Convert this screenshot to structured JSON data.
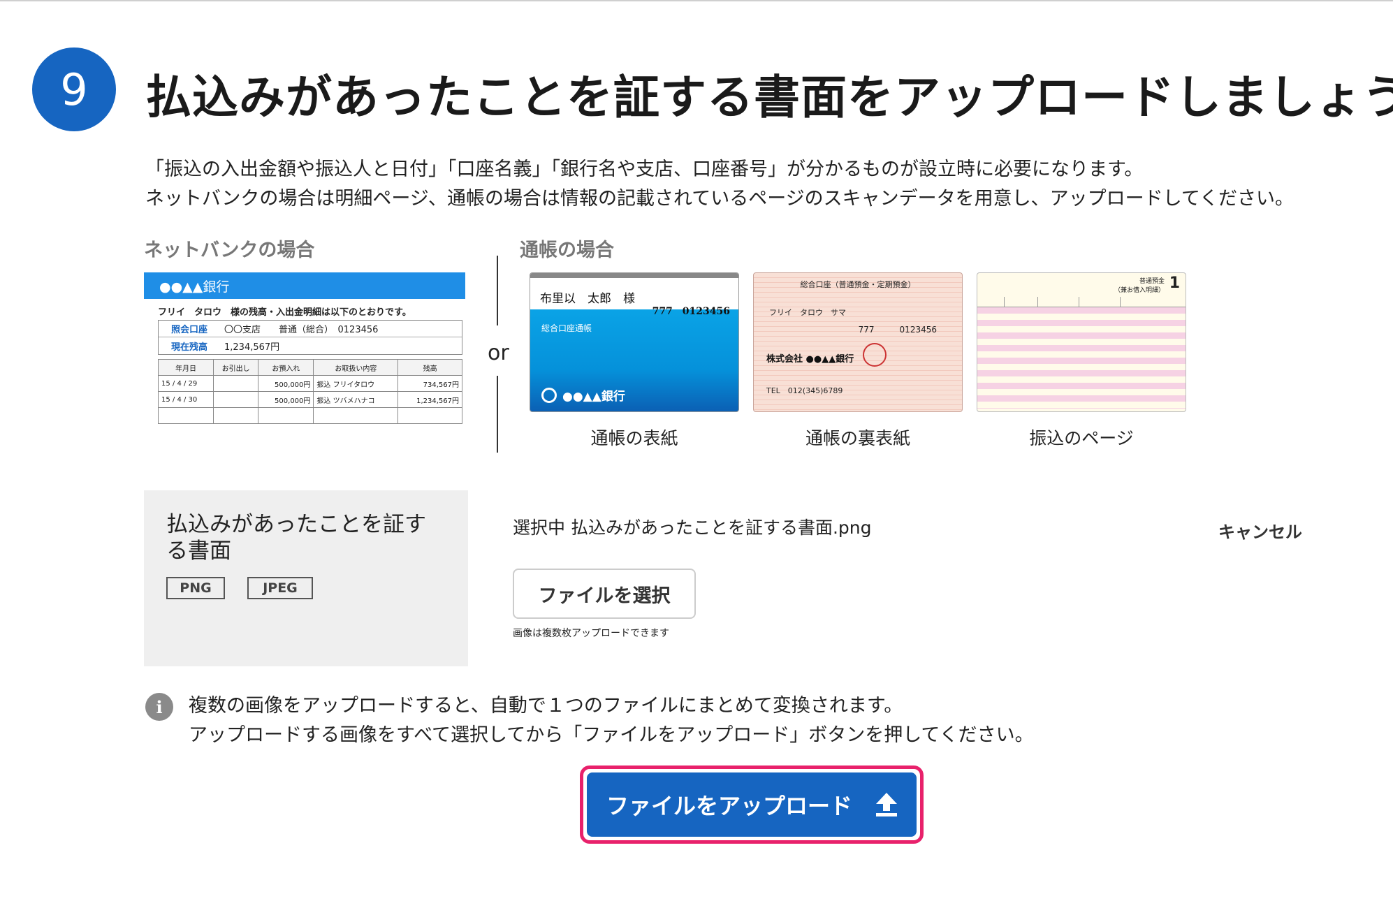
{
  "step": {
    "number": "9",
    "title": "払込みがあったことを証する書面をアップロードしましょう"
  },
  "description": [
    "「振込の入出金額や振込人と日付」「口座名義」「銀行名や支店、口座番号」が分かるものが設立時に必要になります。",
    "ネットバンクの場合は明細ページ、通帳の場合は情報の記載されているページのスキャンデータを用意し、アップロードしてください。"
  ],
  "examples": {
    "netbank_label": "ネットバンクの場合",
    "passbook_label": "通帳の場合",
    "or": "or",
    "netbank": {
      "bank": "●●▲▲銀行",
      "intro": "フリイ　タロウ　様の残高・入出金明細は以下のとおりです。",
      "account_key": "照会口座",
      "account_value": "〇〇支店　　普通（総合）　0123456",
      "balance_key": "現在残高",
      "balance_value": "1,234,567円",
      "headers": [
        "年月日",
        "お引出し",
        "お預入れ",
        "お取扱い内容",
        "残高"
      ],
      "rows": [
        [
          "15 / 4 / 29",
          "",
          "500,000円",
          "振込 フリイタロウ",
          "734,567円"
        ],
        [
          "15 / 4 / 30",
          "",
          "500,000円",
          "振込 ツバメハナコ",
          "1,234,567円"
        ],
        [
          "",
          "",
          "",
          "",
          ""
        ]
      ]
    },
    "cover": {
      "name": "布里以　太郎　様",
      "number": "777　0123456",
      "type": "総合口座通帳",
      "bank": "●●▲▲銀行"
    },
    "back": {
      "title": "総合口座（普通預金・定期預金）",
      "name": "フリイ　タロウ　サマ",
      "number": "777　　　0123456",
      "company": "株式会社 ●●▲▲銀行",
      "tel": "TEL　012(345)6789"
    },
    "page": {
      "header": "普通預金\n（兼お借入明細）",
      "page_no": "1"
    },
    "captions": [
      "通帳の表紙",
      "通帳の裏表紙",
      "振込のページ"
    ]
  },
  "upload": {
    "title": "払込みがあったことを証する書面",
    "formats": [
      "PNG",
      "JPEG"
    ],
    "selected": "選択中 払込みがあったことを証する書面.png",
    "cancel": "キャンセル",
    "choose_button": "ファイルを選択",
    "hint": "画像は複数枚アップロードできます"
  },
  "info": {
    "icon": "info-icon",
    "lines": [
      "複数の画像をアップロードすると、自動で１つのファイルにまとめて変換されます。",
      "アップロードする画像をすべて選択してから「ファイルをアップロード」ボタンを押してください。"
    ]
  },
  "upload_button": {
    "label": "ファイルをアップロード",
    "icon": "upload-arrow-icon"
  },
  "colors": {
    "primary": "#1665c1",
    "highlight": "#e8216b",
    "panel": "#efefef"
  }
}
